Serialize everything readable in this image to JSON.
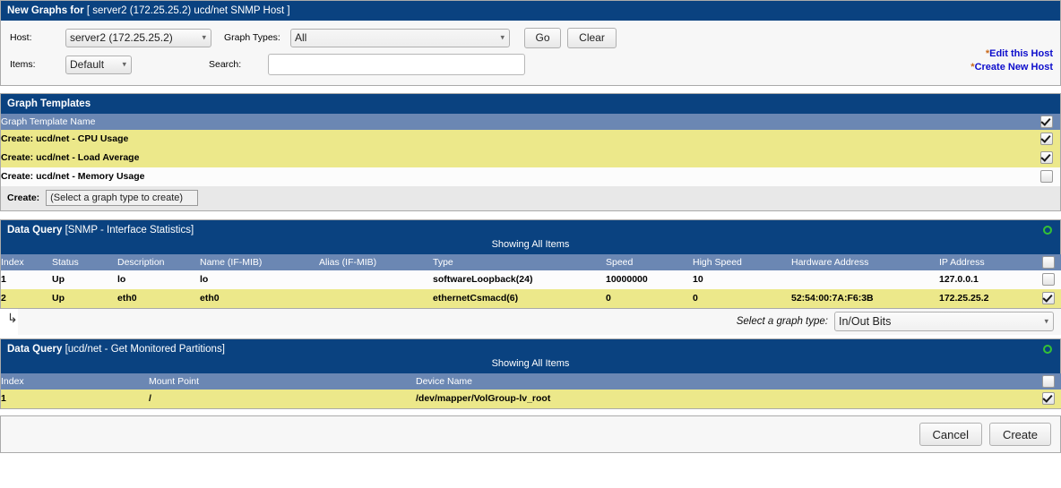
{
  "header": {
    "title_prefix": "New Graphs for",
    "title_target": "[ server2 (172.25.25.2) ucd/net SNMP Host ]"
  },
  "form": {
    "host_label": "Host:",
    "host_value": "server2 (172.25.25.2)",
    "graph_types_label": "Graph Types:",
    "graph_types_value": "All",
    "go_label": "Go",
    "clear_label": "Clear",
    "items_label": "Items:",
    "items_value": "Default",
    "search_label": "Search:",
    "search_value": "",
    "search_placeholder": "",
    "link_edit_host": "Edit this Host",
    "link_create_host": "Create New Host",
    "link_star": "*",
    "link_color": "#0d0dcc",
    "star_color": "#c96a1b"
  },
  "graph_templates": {
    "panel_title": "Graph Templates",
    "column_header": "Graph Template Name",
    "header_checkbox": true,
    "rows": [
      {
        "name": "Create: ucd/net - CPU Usage",
        "checked": true,
        "highlight": true
      },
      {
        "name": "Create: ucd/net - Load Average",
        "checked": true,
        "highlight": true
      },
      {
        "name": "Create: ucd/net - Memory Usage",
        "checked": false,
        "highlight": false
      }
    ],
    "create_label": "Create:",
    "create_select_value": "(Select a graph type to create)"
  },
  "data_query_interface": {
    "panel_title_prefix": "Data Query",
    "panel_title_target": "[SNMP - Interface Statistics]",
    "status_icon": "green-ring-icon",
    "showing": "Showing All Items",
    "columns": [
      "Index",
      "Status",
      "Description",
      "Name (IF-MIB)",
      "Alias (IF-MIB)",
      "Type",
      "Speed",
      "High Speed",
      "Hardware Address",
      "IP Address"
    ],
    "header_checkbox": false,
    "rows": [
      {
        "index": "1",
        "status": "Up",
        "description": "lo",
        "name": "lo",
        "alias": "",
        "type": "softwareLoopback(24)",
        "speed": "10000000",
        "high_speed": "10",
        "hardware_address": "",
        "ip_address": "127.0.0.1",
        "checked": false,
        "highlight": false
      },
      {
        "index": "2",
        "status": "Up",
        "description": "eth0",
        "name": "eth0",
        "alias": "",
        "type": "ethernetCsmacd(6)",
        "speed": "0",
        "high_speed": "0",
        "hardware_address": "52:54:00:7A:F6:3B",
        "ip_address": "172.25.25.2",
        "checked": true,
        "highlight": true
      }
    ],
    "arrow_glyph": "↳",
    "graph_type_label": "Select a graph type:",
    "graph_type_value": "In/Out Bits"
  },
  "data_query_partitions": {
    "panel_title_prefix": "Data Query",
    "panel_title_target": "[ucd/net - Get Monitored Partitions]",
    "status_icon": "green-ring-icon",
    "showing": "Showing All Items",
    "columns": [
      "Index",
      "Mount Point",
      "Device Name"
    ],
    "header_checkbox": false,
    "rows": [
      {
        "index": "1",
        "mount_point": "/",
        "device_name": "/dev/mapper/VolGroup-lv_root",
        "checked": true,
        "highlight": true
      }
    ]
  },
  "footer": {
    "cancel_label": "Cancel",
    "create_label": "Create"
  },
  "colors": {
    "bar_blue": "#0a4280",
    "column_header_blue": "#6b87b3",
    "row_highlight_yellow": "#ece88a",
    "panel_bg": "#f7f7f7",
    "green": "#35c135"
  }
}
